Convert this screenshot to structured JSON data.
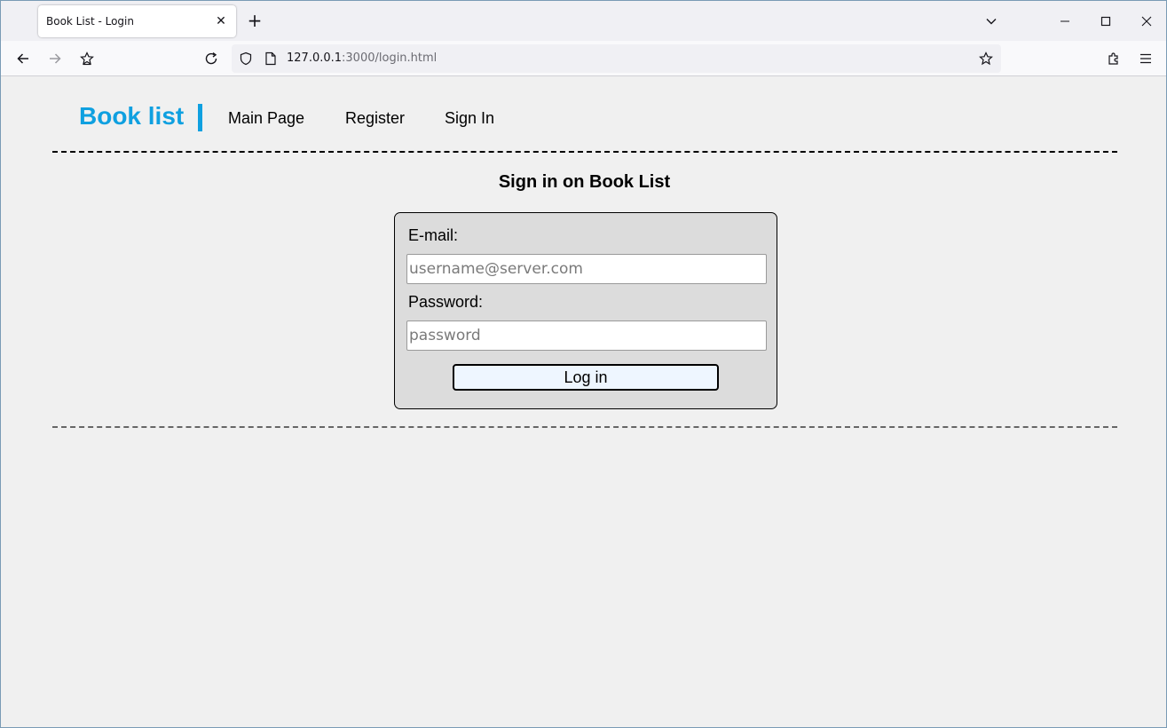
{
  "browser": {
    "tab_title": "Book List - Login",
    "url_host": "127.0.0.1",
    "url_path": ":3000/login.html",
    "icons": {
      "tab_close": "close-icon",
      "new_tab": "plus-icon",
      "tab_list": "chevron-down-icon",
      "minimize": "minimize-icon",
      "maximize": "maximize-icon",
      "close_window": "close-icon",
      "back": "back-arrow-icon",
      "forward": "forward-arrow-icon",
      "home": "home-icon",
      "reload": "reload-icon",
      "shield": "shield-icon",
      "page": "page-icon",
      "bookmark": "star-icon",
      "extensions": "puzzle-icon",
      "menu": "hamburger-menu-icon"
    }
  },
  "nav": {
    "brand": "Book list",
    "links": [
      "Main Page",
      "Register",
      "Sign In"
    ]
  },
  "login": {
    "heading": "Sign in on Book List",
    "email_label": "E-mail:",
    "email_placeholder": "username@server.com",
    "email_value": "",
    "password_label": "Password:",
    "password_placeholder": "password",
    "password_value": "",
    "button_label": "Log in"
  },
  "colors": {
    "brand": "#0fa0e0",
    "card_background": "#dcdcdc",
    "button_background": "#eef6ff",
    "page_background": "#f0f0f0"
  }
}
